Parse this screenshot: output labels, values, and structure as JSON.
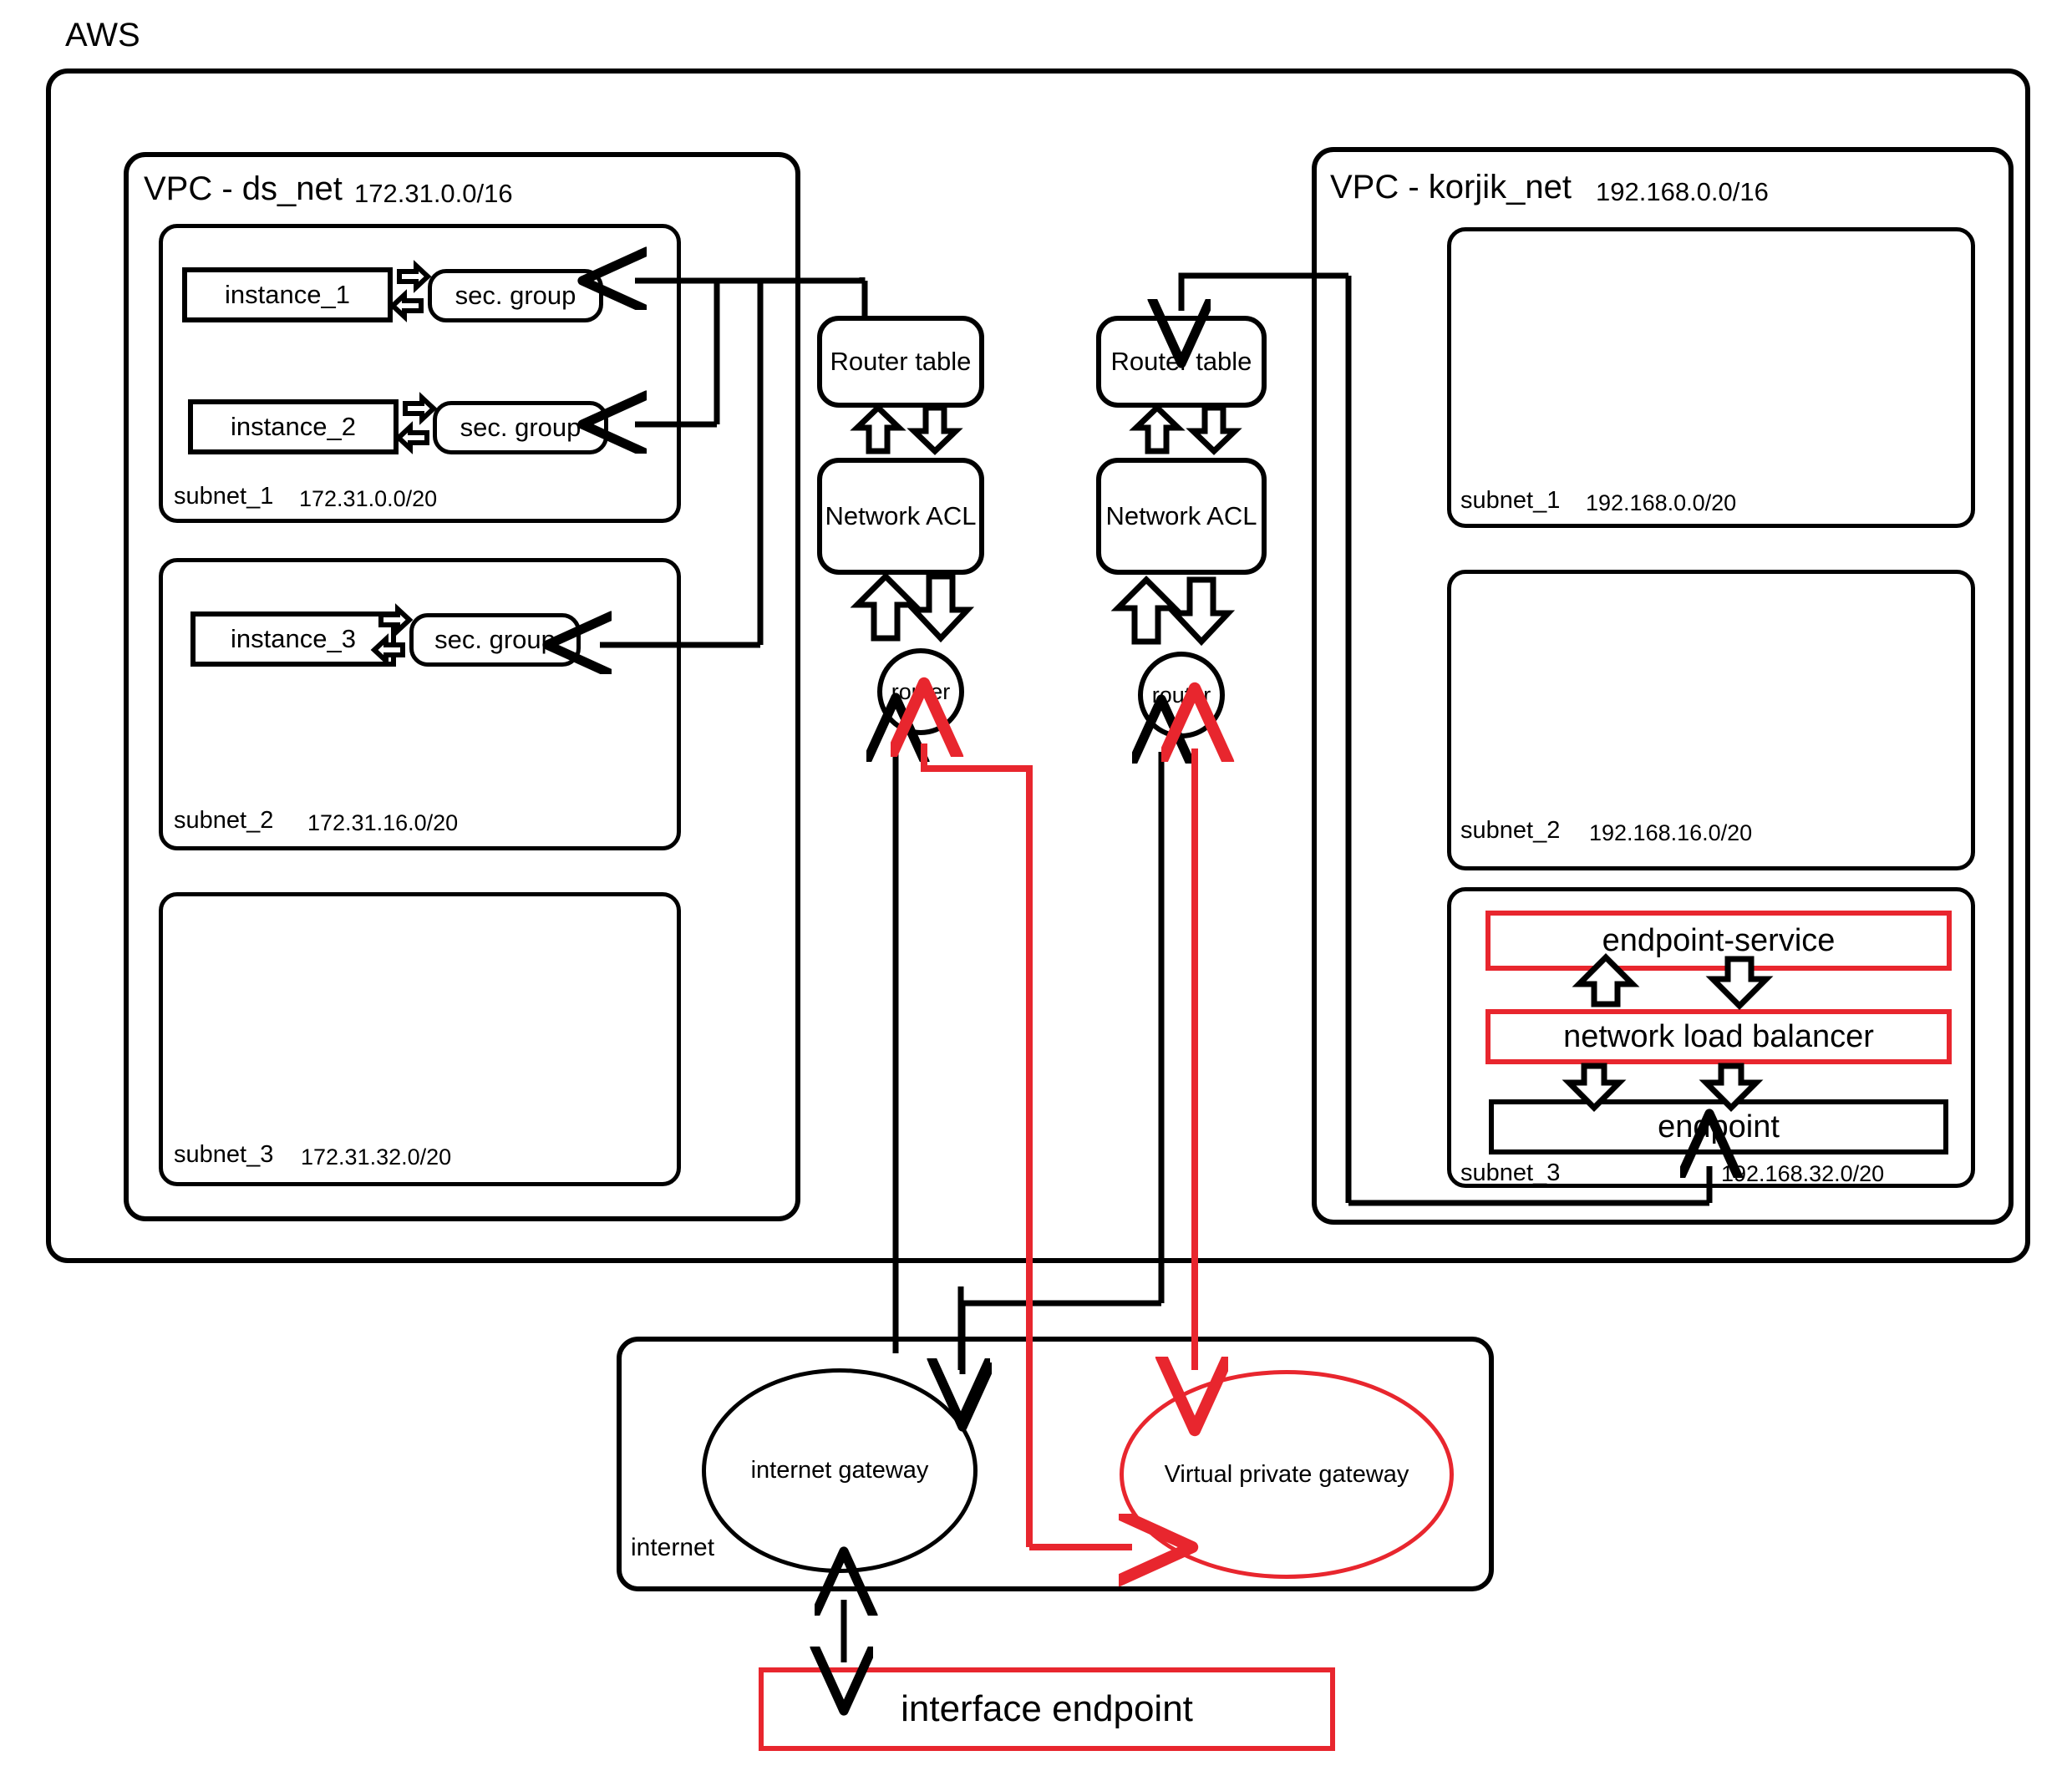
{
  "diagram": {
    "title": "AWS",
    "colors": {
      "line": "#000000",
      "accent_red": "#e8262e",
      "background": "#ffffff"
    }
  },
  "aws": {
    "label": "AWS"
  },
  "vpcs": [
    {
      "name": "VPC - ds_net",
      "cidr": "172.31.0.0/16",
      "subnets": [
        {
          "name": "subnet_1",
          "cidr": "172.31.0.0/20",
          "instances": [
            {
              "name": "instance_1",
              "sec_group": "sec. group"
            },
            {
              "name": "instance_2",
              "sec_group": "sec. group"
            }
          ]
        },
        {
          "name": "subnet_2",
          "cidr": "172.31.16.0/20",
          "instances": [
            {
              "name": "instance_3",
              "sec_group": "sec. group"
            }
          ]
        },
        {
          "name": "subnet_3",
          "cidr": "172.31.32.0/20",
          "instances": []
        }
      ]
    },
    {
      "name": "VPC - korjik_net",
      "cidr": "192.168.0.0/16",
      "subnets": [
        {
          "name": "subnet_1",
          "cidr": "192.168.0.0/20",
          "instances": []
        },
        {
          "name": "subnet_2",
          "cidr": "192.168.16.0/20",
          "instances": []
        },
        {
          "name": "subnet_3",
          "cidr": "192.168.32.0/20",
          "services": [
            {
              "label": "endpoint-service",
              "color": "red"
            },
            {
              "label": "network load balancer",
              "color": "red"
            },
            {
              "label": "endpoint",
              "color": "black"
            }
          ]
        }
      ]
    }
  ],
  "network_stacks": [
    {
      "router_table": "Router table",
      "network_acl": "Network ACL",
      "router": "router"
    },
    {
      "router_table": "Router table",
      "network_acl": "Network ACL",
      "router": "router"
    }
  ],
  "internet": {
    "label": "internet",
    "gateways": [
      {
        "label": "internet gateway",
        "color": "black"
      },
      {
        "label": "Virtual private gateway",
        "color": "red"
      }
    ]
  },
  "interface_endpoint": {
    "label": "interface endpoint",
    "color": "red"
  }
}
